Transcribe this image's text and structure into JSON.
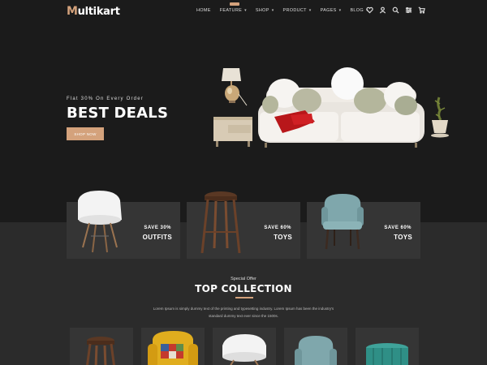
{
  "header": {
    "logo_first": "M",
    "logo_rest": "ultikart",
    "nav": [
      {
        "label": "HOME",
        "has_menu": false
      },
      {
        "label": "FEATURE",
        "has_menu": true
      },
      {
        "label": "SHOP",
        "has_menu": true
      },
      {
        "label": "PRODUCT",
        "has_menu": true
      },
      {
        "label": "PAGES",
        "has_menu": true
      },
      {
        "label": "BLOG",
        "has_menu": true
      }
    ],
    "icons": [
      "heart-icon",
      "user-icon",
      "search-icon",
      "settings-icon",
      "cart-icon"
    ]
  },
  "hero": {
    "subtitle": "Flat 30% On Every Order",
    "title": "BEST DEALS",
    "button": "SHOP NOW"
  },
  "cards": [
    {
      "save": "SAVE 30%",
      "title": "OUTFITS"
    },
    {
      "save": "SAVE 60%",
      "title": "TOYS"
    },
    {
      "save": "SAVE 60%",
      "title": "TOYS"
    }
  ],
  "collection": {
    "subtitle": "Special Offer",
    "title": "TOP COLLECTION",
    "description": "Lorem Ipsum is simply dummy text of the printing and typesetting industry. Lorem Ipsum has been the industry's standard dummy text ever since the 1500s."
  },
  "colors": {
    "accent": "#d4a27c",
    "header_bg": "#1b1b1b",
    "page_bg": "#2b2b2b",
    "card_bg": "#353535"
  }
}
